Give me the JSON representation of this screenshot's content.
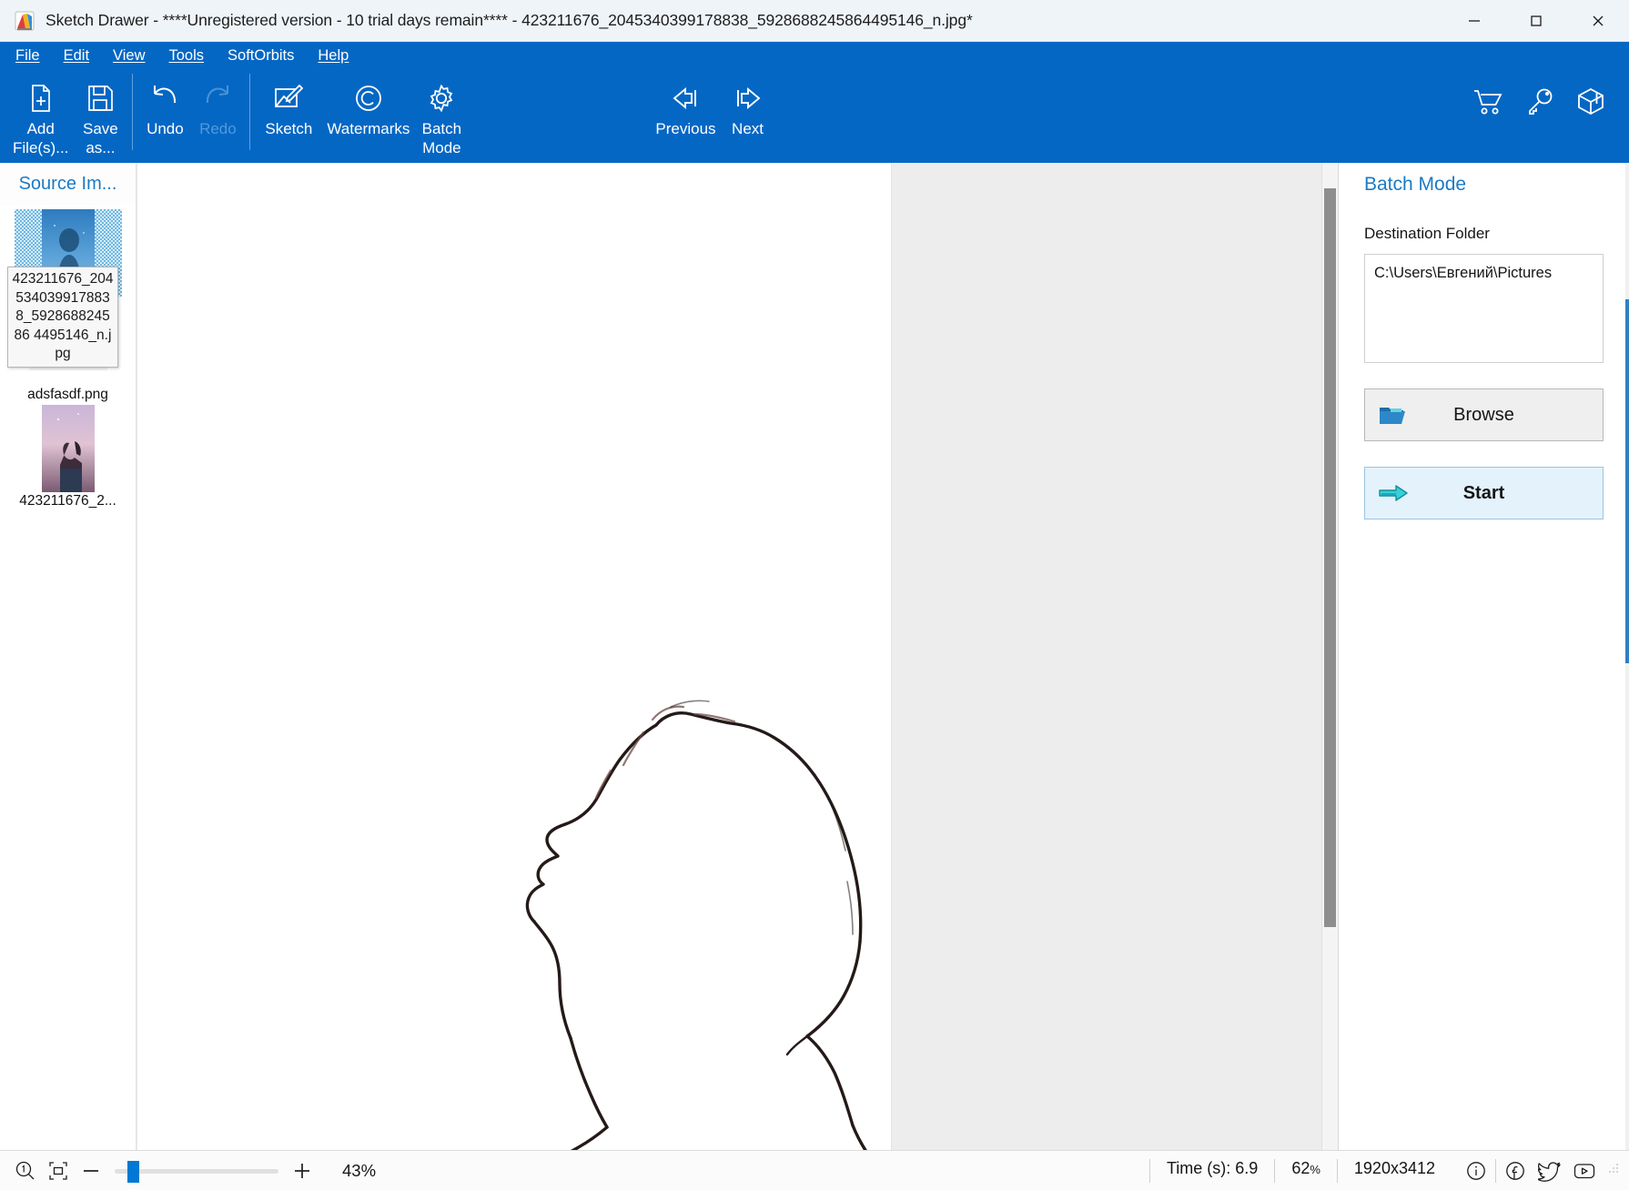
{
  "window": {
    "title": "Sketch Drawer - ****Unregistered version - 10 trial days remain**** - 423211676_2045340399178838_5928688245864495146_n.jpg*",
    "app_icon": "sketch-drawer-logo-icon",
    "controls": {
      "minimize": "minimize-icon",
      "maximize": "maximize-icon",
      "close": "close-icon"
    }
  },
  "menubar": {
    "items": [
      {
        "label": "File",
        "accel": "F"
      },
      {
        "label": "Edit",
        "accel": "E"
      },
      {
        "label": "View",
        "accel": "V"
      },
      {
        "label": "Tools",
        "accel": "T"
      },
      {
        "label": "SoftOrbits",
        "accel": ""
      },
      {
        "label": "Help",
        "accel": "H"
      }
    ]
  },
  "toolbar": {
    "buttons": [
      {
        "label": "Add\nFile(s)...",
        "icon": "add-file-icon",
        "enabled": true
      },
      {
        "label": "Save\nas...",
        "icon": "save-as-icon",
        "enabled": true
      },
      {
        "label": "Undo",
        "icon": "undo-arrow-icon",
        "enabled": true
      },
      {
        "label": "Redo",
        "icon": "redo-arrow-icon",
        "enabled": false
      },
      {
        "label": "Sketch",
        "icon": "sketch-picture-pencil-icon",
        "enabled": true
      },
      {
        "label": "Watermarks",
        "icon": "copyright-icon",
        "enabled": true
      },
      {
        "label": "Batch\nMode",
        "icon": "gear-icon",
        "enabled": true
      },
      {
        "label": "Previous",
        "icon": "previous-arrow-icon",
        "enabled": true
      },
      {
        "label": "Next",
        "icon": "next-arrow-icon",
        "enabled": true
      }
    ],
    "right_icons": [
      {
        "name": "shopping-cart-icon"
      },
      {
        "name": "key-icon"
      },
      {
        "name": "package-box-icon"
      }
    ]
  },
  "sidebar": {
    "title": "Source Im...",
    "tooltip": "423211676_2045340399178838_592868824586 4495146_n.jpg",
    "thumbnails": [
      {
        "label": "",
        "selected": true,
        "name": "thumbnail-source-image-1"
      },
      {
        "label": "adsfasdf.png",
        "selected": false,
        "name": "thumbnail-adsfasdf"
      },
      {
        "label": "423211676_2...",
        "selected": false,
        "name": "thumbnail-source-image-3"
      }
    ]
  },
  "canvas": {
    "image_name": "sketch-preview-profile-portrait",
    "background": "#ffffff",
    "outer_background": "#ededed"
  },
  "right_panel": {
    "title": "Batch Mode",
    "destination_label": "Destination Folder",
    "destination_value": "C:\\Users\\Евгений\\Pictures",
    "browse_label": "Browse",
    "browse_icon": "folder-open-icon",
    "start_label": "Start",
    "start_icon": "arrow-right-icon"
  },
  "statusbar": {
    "zoom_reset_icon": "zoom-100-percent-icon",
    "fit_icon": "fit-to-window-icon",
    "zoom_out_icon": "minus-icon",
    "zoom_in_icon": "plus-icon",
    "zoom_value": "43%",
    "time_label": "Time (s): 6.9",
    "progress": "62",
    "progress_unit": "%",
    "dimensions": "1920x3412",
    "info_icon": "info-circle-icon",
    "facebook_icon": "facebook-icon",
    "twitter_icon": "twitter-icon",
    "youtube_icon": "youtube-icon"
  },
  "colors": {
    "accent_blue": "#0567c4",
    "title_link_blue": "#1b7ac4",
    "slider_blue": "#0078d4",
    "panel_gray": "#ededed"
  }
}
